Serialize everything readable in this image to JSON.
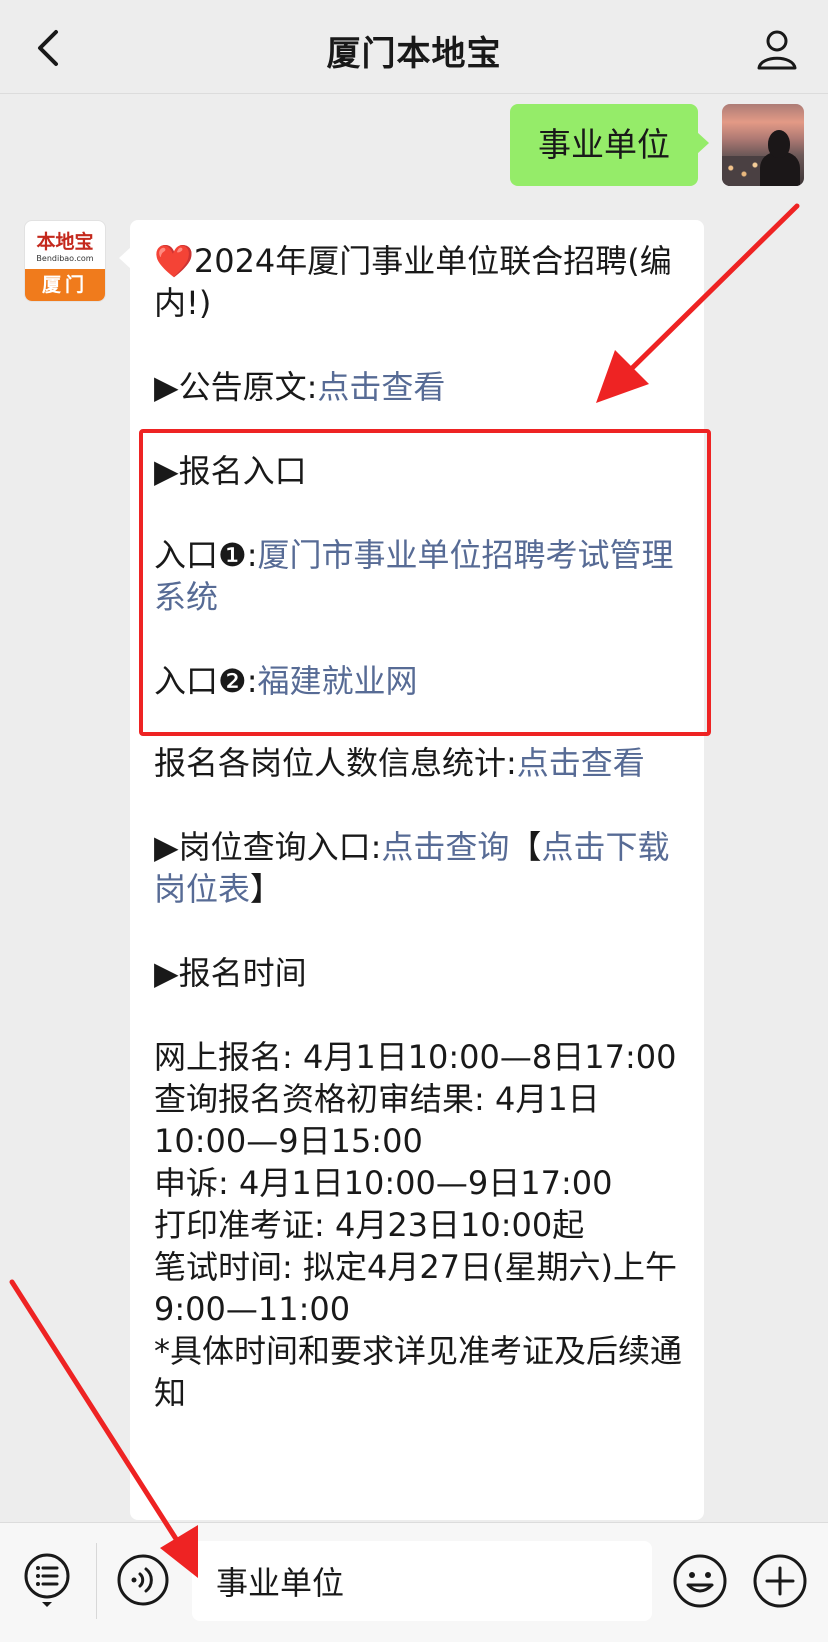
{
  "nav": {
    "title": "厦门本地宝",
    "back_icon": "chevron-left-icon",
    "user_icon": "person-icon"
  },
  "sent_message": {
    "text": "事业单位"
  },
  "bot_avatar": {
    "logo_top": "本地宝",
    "logo_url": "Bendibao.com",
    "logo_bottom": "厦门"
  },
  "message": {
    "title_emoji": "❤️",
    "title": "2024年厦门事业单位联合招聘(编内!)",
    "notice_label": "▶公告原文:",
    "notice_link": "点击查看",
    "register_heading": "▶报名入口",
    "entry1_label": "入口❶:",
    "entry1_link": "厦门市事业单位招聘考试管理系统",
    "entry2_label": "入口❷:",
    "entry2_link": "福建就业网",
    "stats_label": "报名各岗位人数信息统计:",
    "stats_link": "点击查看",
    "position_label": "▶岗位查询入口:",
    "position_link": "点击查询",
    "bracket_open": "【",
    "download_link": "点击下载岗位表",
    "bracket_close": "】",
    "time_heading": "▶报名时间",
    "t1": "网上报名: 4月1日10:00—8日17:00",
    "t2": "查询报名资格初审结果: 4月1日10:00—9日15:00",
    "t3": "申诉: 4月1日10:00—9日17:00",
    "t4": "打印准考证: 4月23日10:00起",
    "t5": "笔试时间: 拟定4月27日(星期六)上午9:00—11:00",
    "t6": "*具体时间和要求详见准考证及后续通知"
  },
  "input_bar": {
    "value": "事业单位",
    "menu_icon": "menu-list-icon",
    "voice_icon": "voice-icon",
    "emoji_icon": "emoji-icon",
    "plus_icon": "plus-icon"
  },
  "colors": {
    "link": "#576b95",
    "sent_bubble": "#95ec69",
    "highlight": "#ee2323",
    "arrow": "#ee2323"
  }
}
